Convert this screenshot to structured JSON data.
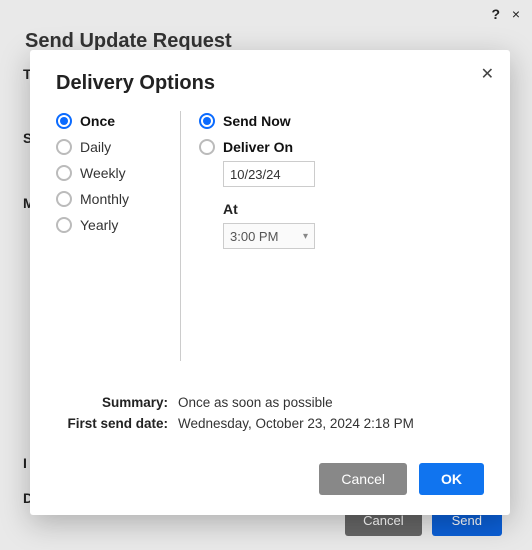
{
  "bg": {
    "title": "Send Update Request",
    "t": "T",
    "s": "S",
    "m": "M",
    "l": "I",
    "d": "D",
    "help": "?",
    "x": "×",
    "cancel": "Cancel",
    "send": "Send"
  },
  "modal": {
    "title": "Delivery Options",
    "close": "✕",
    "frequency": {
      "selected": "once",
      "options": {
        "once": "Once",
        "daily": "Daily",
        "weekly": "Weekly",
        "monthly": "Monthly",
        "yearly": "Yearly"
      }
    },
    "timing": {
      "selected": "send_now",
      "send_now": "Send Now",
      "deliver_on": "Deliver On",
      "date_value": "10/23/24",
      "at_label": "At",
      "time_value": "3:00 PM"
    },
    "summary": {
      "label": "Summary:",
      "value": "Once as soon as possible"
    },
    "first_send": {
      "label": "First send date:",
      "value": "Wednesday, October 23, 2024 2:18 PM"
    },
    "buttons": {
      "cancel": "Cancel",
      "ok": "OK"
    }
  }
}
